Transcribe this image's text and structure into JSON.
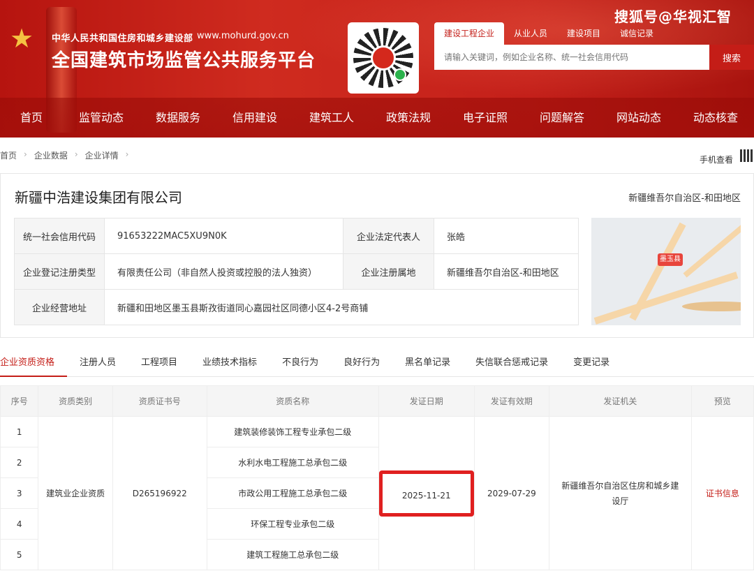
{
  "header": {
    "ministry": "中华人民共和国住房和城乡建设部",
    "domain": "www.mohurd.gov.cn",
    "platform_title": "全国建筑市场监管公共服务平台",
    "watermark": "搜狐号@华视汇智",
    "search_tabs": [
      "建设工程企业",
      "从业人员",
      "建设项目",
      "诚信记录"
    ],
    "search_placeholder": "请输入关键词，例如企业名称、统一社会信用代码",
    "search_button": "搜索",
    "nav": [
      "首页",
      "监管动态",
      "数据服务",
      "信用建设",
      "建筑工人",
      "政策法规",
      "电子证照",
      "问题解答",
      "网站动态",
      "动态核查"
    ]
  },
  "breadcrumb": [
    "首页",
    "企业数据",
    "企业详情"
  ],
  "mobile_view": "手机查看",
  "company": {
    "name": "新疆中浩建设集团有限公司",
    "region": "新疆维吾尔自治区-和田地区",
    "credit_code_label": "统一社会信用代码",
    "credit_code": "91653222MAC5XU9N0K",
    "legal_rep_label": "企业法定代表人",
    "legal_rep": "张皓",
    "reg_type_label": "企业登记注册类型",
    "reg_type": "有限责任公司（非自然人投资或控股的法人独资）",
    "reg_place_label": "企业注册属地",
    "reg_place": "新疆维吾尔自治区-和田地区",
    "address_label": "企业经营地址",
    "address": "新疆和田地区墨玉县斯孜街道同心嘉园社区同德小区4-2号商铺",
    "map_pin": "墨玉县"
  },
  "tabs": [
    "企业资质资格",
    "注册人员",
    "工程项目",
    "业绩技术指标",
    "不良行为",
    "良好行为",
    "黑名单记录",
    "失信联合惩戒记录",
    "变更记录"
  ],
  "qualifications": {
    "headers": [
      "序号",
      "资质类别",
      "资质证书号",
      "资质名称",
      "发证日期",
      "发证有效期",
      "发证机关",
      "预览"
    ],
    "category": "建筑业企业资质",
    "cert_no": "D265196922",
    "issue_date": "2025-11-21",
    "valid_until": "2029-07-29",
    "authority": "新疆维吾尔自治区住房和城乡建设厅",
    "preview_link": "证书信息",
    "rows": [
      {
        "no": "1",
        "name": "建筑装修装饰工程专业承包二级"
      },
      {
        "no": "2",
        "name": "水利水电工程施工总承包二级"
      },
      {
        "no": "3",
        "name": "市政公用工程施工总承包二级"
      },
      {
        "no": "4",
        "name": "环保工程专业承包二级"
      },
      {
        "no": "5",
        "name": "建筑工程施工总承包二级"
      }
    ]
  }
}
